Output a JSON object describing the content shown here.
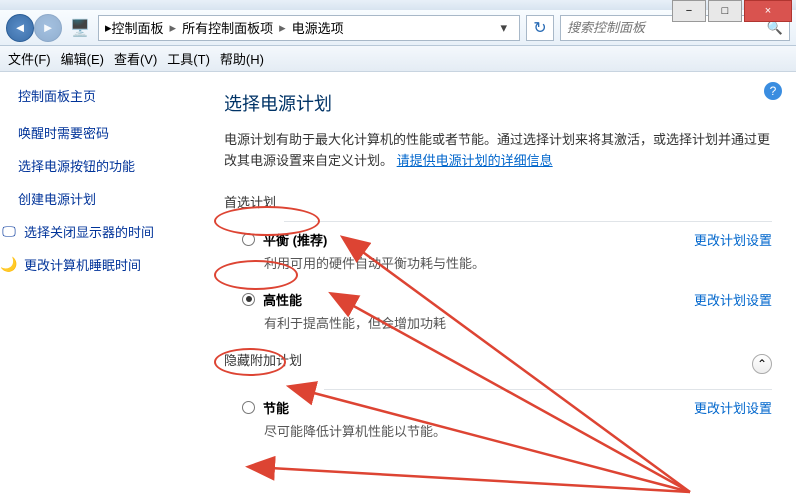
{
  "window": {
    "minimize": "−",
    "maximize": "□",
    "close": "×"
  },
  "nav": {
    "back": "◄",
    "forward": "►",
    "explorer_icon": "🖥️",
    "crumbs": [
      "控制面板",
      "所有控制面板项",
      "电源选项"
    ],
    "sep": "▸",
    "dropdown": "▾",
    "refresh": "↻",
    "search_placeholder": "搜索控制面板",
    "search_icon": "🔍"
  },
  "menu": {
    "file": "文件(F)",
    "edit": "编辑(E)",
    "view": "查看(V)",
    "tools": "工具(T)",
    "help": "帮助(H)"
  },
  "sidebar": {
    "home": "控制面板主页",
    "links": [
      "唤醒时需要密码",
      "选择电源按钮的功能",
      "创建电源计划"
    ],
    "display_link": "选择关闭显示器的时间",
    "sleep_link": "更改计算机睡眠时间",
    "display_icon": "🖵",
    "sleep_icon": "🌙"
  },
  "main": {
    "help": "?",
    "title": "选择电源计划",
    "description_prefix": "电源计划有助于最大化计算机的性能或者节能。通过选择计划来将其激活，或选择计划并通过更改其电源设置来自定义计划。",
    "detail_link": "请提供电源计划的详细信息",
    "pref_section": "首选计划",
    "hidden_section": "隐藏附加计划",
    "change_label": "更改计划设置",
    "collapse": "⌃",
    "plans": [
      {
        "name": "平衡 (推荐)",
        "desc": "利用可用的硬件自动平衡功耗与性能。",
        "checked": false
      },
      {
        "name": "高性能",
        "desc": "有利于提高性能，但会增加功耗",
        "checked": true
      }
    ],
    "hidden_plans": [
      {
        "name": "节能",
        "desc": "尽可能降低计算机性能以节能。",
        "checked": false
      }
    ]
  }
}
